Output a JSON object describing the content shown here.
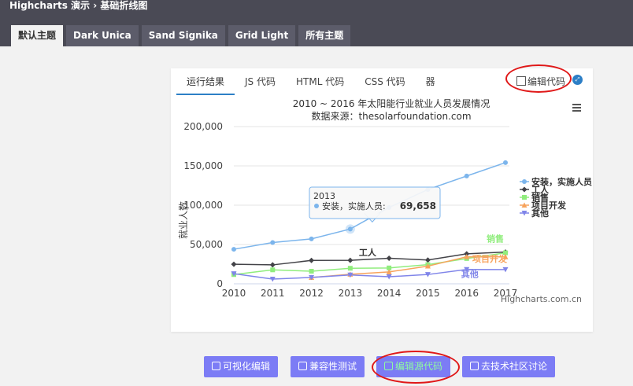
{
  "header": {
    "title": "Highcharts 演示 › 基础折线图",
    "tabs": [
      "默认主题",
      "Dark Unica",
      "Sand Signika",
      "Grid Light",
      "所有主题"
    ]
  },
  "panel": {
    "tabs": [
      "运行结果",
      "JS 代码",
      "HTML 代码",
      "CSS 代码",
      "器"
    ],
    "edit_label": "编辑代码"
  },
  "chart_data": {
    "type": "line",
    "title": "2010 ~ 2016 年太阳能行业就业人员发展情况",
    "subtitle": "数据来源：thesolarfoundation.com",
    "ylabel": "就业人数",
    "xlabel": "",
    "x": [
      2010,
      2011,
      2012,
      2013,
      2014,
      2015,
      2016,
      2017
    ],
    "ylim": [
      0,
      200000
    ],
    "yticks": [
      "0",
      "50,000",
      "100,000",
      "150,000",
      "200,000"
    ],
    "grid": true,
    "legend_position": "right",
    "series": [
      {
        "name": "安装，实施人员",
        "color": "#7cb5ec",
        "marker": "circle",
        "values": [
          43934,
          52503,
          57177,
          69658,
          97031,
          119931,
          137133,
          154175
        ]
      },
      {
        "name": "工人",
        "color": "#434348",
        "marker": "diamond",
        "values": [
          24916,
          24064,
          29742,
          29851,
          32490,
          30282,
          38121,
          40434
        ]
      },
      {
        "name": "销售",
        "color": "#90ed7d",
        "marker": "square",
        "values": [
          11744,
          17722,
          16005,
          19771,
          20185,
          24377,
          32147,
          39387
        ]
      },
      {
        "name": "项目开发",
        "color": "#f7a35c",
        "marker": "triangle",
        "values": [
          null,
          null,
          7988,
          12169,
          15112,
          22452,
          34400,
          34227
        ]
      },
      {
        "name": "其他",
        "color": "#8085e9",
        "marker": "triangle-down",
        "values": [
          12908,
          5948,
          8105,
          11248,
          8989,
          11816,
          18274,
          18111
        ]
      }
    ],
    "data_labels": [
      "工人",
      "销售",
      "项目开发",
      "其他"
    ],
    "tooltip": {
      "x": "2013",
      "series": "安装，实施人员",
      "value": "69,658"
    },
    "credit": "Highcharts.com.cn"
  },
  "buttons": [
    "可视化编辑",
    "兼容性测试",
    "编辑源代码",
    "去技术社区讨论"
  ],
  "colors": {
    "topbar": "#4a4a55",
    "accent": "#2d7fc6",
    "button": "#7c7cf5",
    "annotation": "#e01818"
  }
}
